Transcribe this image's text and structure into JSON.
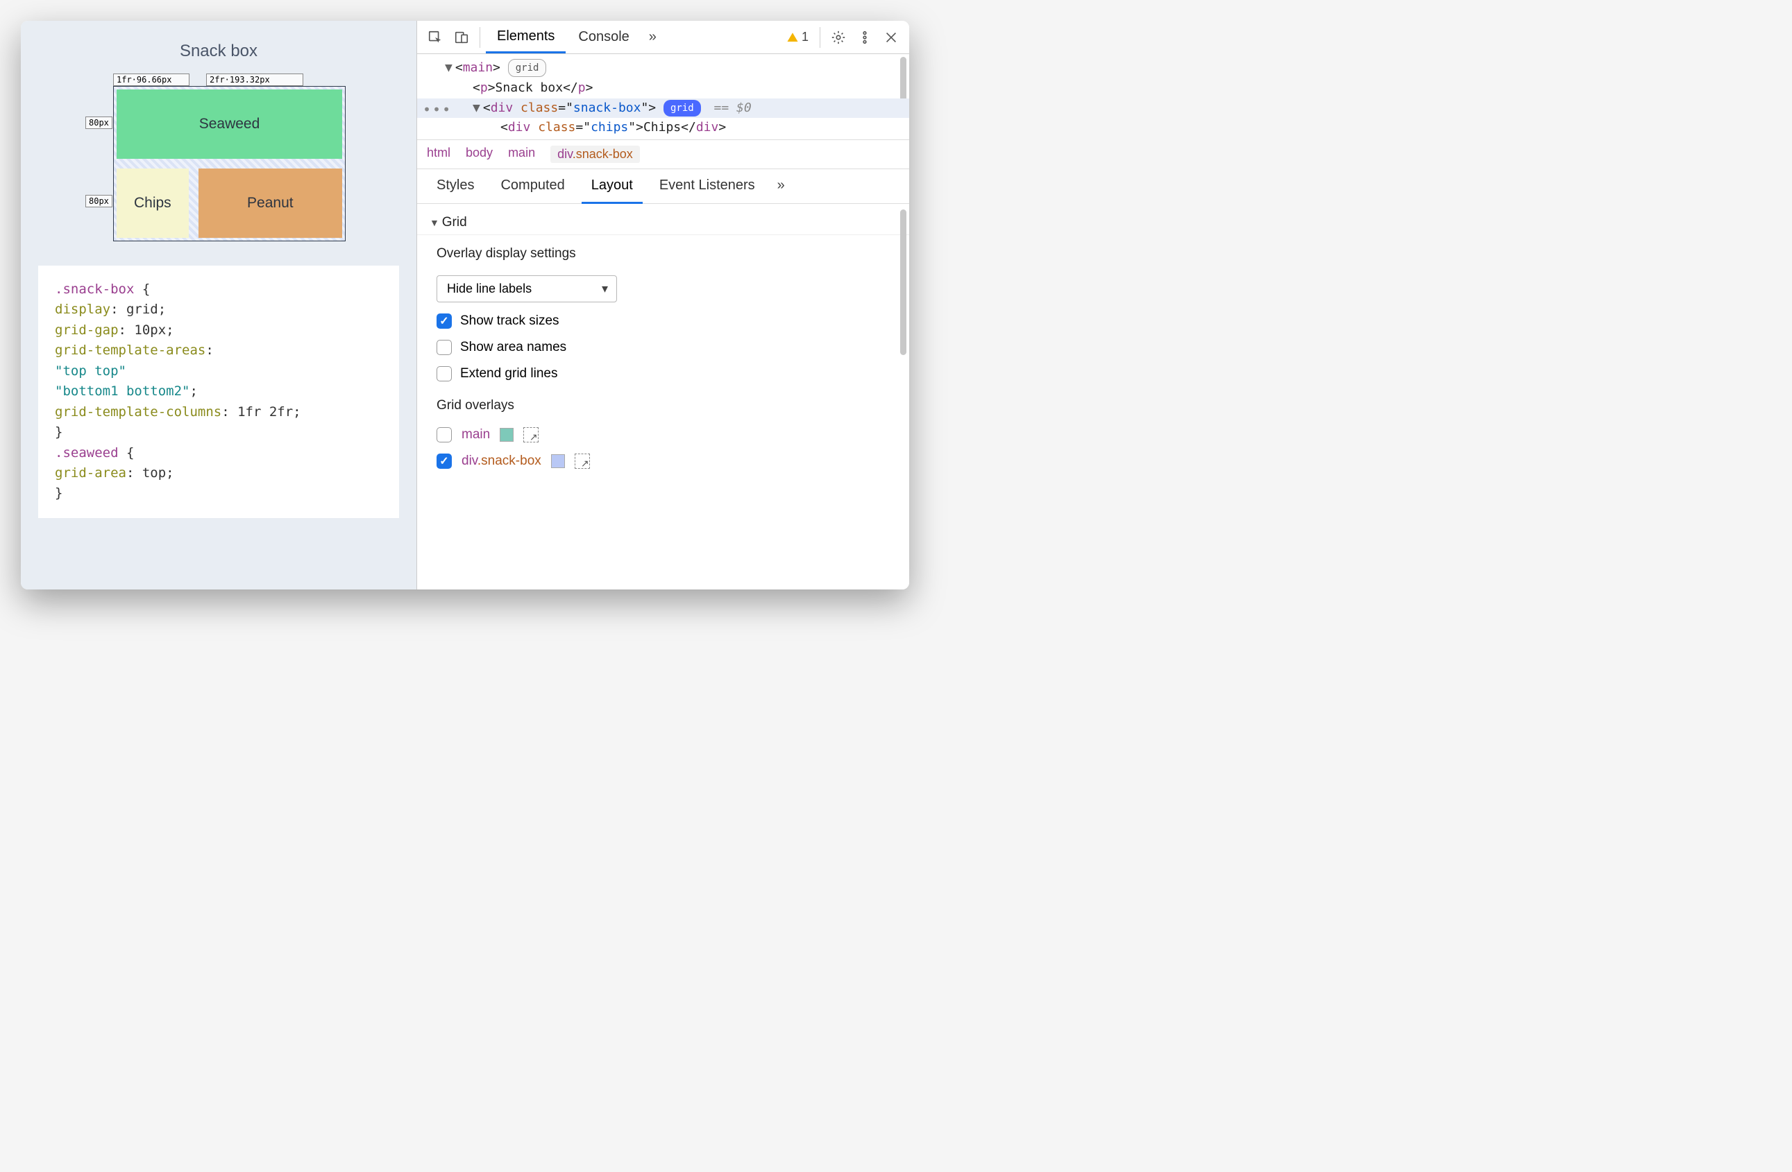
{
  "page": {
    "title": "Snack box",
    "grid": {
      "col_labels": [
        "1fr·96.66px",
        "2fr·193.32px"
      ],
      "row_labels": [
        "80px",
        "80px"
      ],
      "cells": {
        "seaweed": "Seaweed",
        "chips": "Chips",
        "peanut": "Peanut"
      }
    },
    "css_lines": [
      [
        {
          "t": ".snack-box ",
          "c": "sel"
        },
        {
          "t": "{"
        }
      ],
      [
        {
          "t": "  "
        },
        {
          "t": "display",
          "c": "prop"
        },
        {
          "t": ": grid;"
        }
      ],
      [
        {
          "t": "  "
        },
        {
          "t": "grid-gap",
          "c": "prop"
        },
        {
          "t": ": 10px;"
        }
      ],
      [
        {
          "t": "  "
        },
        {
          "t": "grid-template-areas",
          "c": "prop"
        },
        {
          "t": ":"
        }
      ],
      [
        {
          "t": "  "
        },
        {
          "t": "\"top top\"",
          "c": "str"
        }
      ],
      [
        {
          "t": "  "
        },
        {
          "t": "\"bottom1 bottom2\"",
          "c": "str"
        },
        {
          "t": ";"
        }
      ],
      [
        {
          "t": "  "
        },
        {
          "t": "grid-template-columns",
          "c": "prop"
        },
        {
          "t": ": 1fr 2fr;"
        }
      ],
      [
        {
          "t": "}"
        }
      ],
      [
        {
          "t": " "
        }
      ],
      [
        {
          "t": ".seaweed ",
          "c": "sel"
        },
        {
          "t": "{"
        }
      ],
      [
        {
          "t": "  "
        },
        {
          "t": "grid-area",
          "c": "prop"
        },
        {
          "t": ": top;"
        }
      ],
      [
        {
          "t": "}"
        }
      ]
    ]
  },
  "devtools": {
    "tabs": {
      "elements": "Elements",
      "console": "Console"
    },
    "warning_count": "1",
    "dom": {
      "l1_tag": "main",
      "l1_pill": "grid",
      "l2_tag": "p",
      "l2_text": "Snack box",
      "l3_tag": "div",
      "l3_attr": "class",
      "l3_val": "snack-box",
      "l3_pill": "grid",
      "l3_suffix": "== $0",
      "l4_tag": "div",
      "l4_attr": "class",
      "l4_val": "chips",
      "l4_text": "Chips"
    },
    "breadcrumb": [
      "html",
      "body",
      "main",
      "div.snack-box"
    ],
    "side_tabs": [
      "Styles",
      "Computed",
      "Layout",
      "Event Listeners"
    ],
    "grid_section": "Grid",
    "overlay_settings": {
      "heading": "Overlay display settings",
      "select_value": "Hide line labels",
      "checks": [
        {
          "label": "Show track sizes",
          "checked": true
        },
        {
          "label": "Show area names",
          "checked": false
        },
        {
          "label": "Extend grid lines",
          "checked": false
        }
      ]
    },
    "grid_overlays": {
      "heading": "Grid overlays",
      "items": [
        {
          "tag": "main",
          "cls": "",
          "checked": false,
          "color": "#7ec9b9"
        },
        {
          "tag": "div",
          "cls": ".snack-box",
          "checked": true,
          "color": "#b9c8f5"
        }
      ]
    }
  }
}
